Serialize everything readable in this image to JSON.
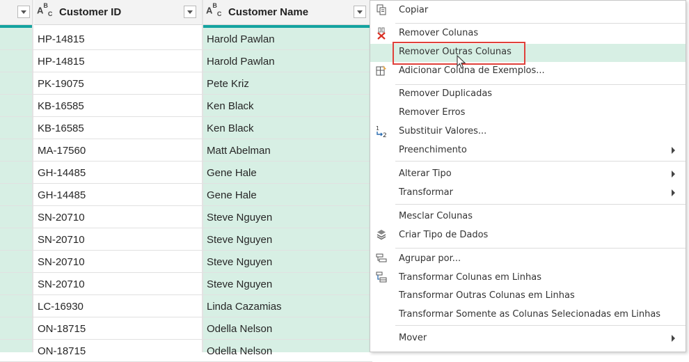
{
  "table": {
    "columns": [
      {
        "type_icon": "ABC",
        "name": "Customer ID"
      },
      {
        "type_icon": "ABC",
        "name": "Customer Name"
      }
    ],
    "rows": [
      {
        "customer_id": "HP-14815",
        "customer_name": "Harold Pawlan"
      },
      {
        "customer_id": "HP-14815",
        "customer_name": "Harold Pawlan"
      },
      {
        "customer_id": "PK-19075",
        "customer_name": "Pete Kriz"
      },
      {
        "customer_id": "KB-16585",
        "customer_name": "Ken Black"
      },
      {
        "customer_id": "KB-16585",
        "customer_name": "Ken Black"
      },
      {
        "customer_id": "MA-17560",
        "customer_name": "Matt Abelman"
      },
      {
        "customer_id": "GH-14485",
        "customer_name": "Gene Hale"
      },
      {
        "customer_id": "GH-14485",
        "customer_name": "Gene Hale"
      },
      {
        "customer_id": "SN-20710",
        "customer_name": "Steve Nguyen"
      },
      {
        "customer_id": "SN-20710",
        "customer_name": "Steve Nguyen"
      },
      {
        "customer_id": "SN-20710",
        "customer_name": "Steve Nguyen"
      },
      {
        "customer_id": "SN-20710",
        "customer_name": "Steve Nguyen"
      },
      {
        "customer_id": "LC-16930",
        "customer_name": "Linda Cazamias"
      },
      {
        "customer_id": "ON-18715",
        "customer_name": "Odella Nelson"
      },
      {
        "customer_id": "ON-18715",
        "customer_name": "Odella Nelson"
      }
    ]
  },
  "context_menu": {
    "items": [
      {
        "label": "Copiar",
        "icon": "copy-icon"
      },
      {
        "label": "Remover Colunas",
        "icon": "remove-columns-icon"
      },
      {
        "label": "Remover Outras Colunas",
        "icon": "",
        "highlighted": true
      },
      {
        "label": "Adicionar Coluna de Exemplos...",
        "icon": "column-from-examples-icon"
      },
      {
        "label": "Remover Duplicadas",
        "icon": ""
      },
      {
        "label": "Remover Erros",
        "icon": ""
      },
      {
        "label": "Substituir Valores...",
        "icon": "replace-values-icon"
      },
      {
        "label": "Preenchimento",
        "icon": "",
        "submenu": true
      },
      {
        "label": "Alterar Tipo",
        "icon": "",
        "submenu": true
      },
      {
        "label": "Transformar",
        "icon": "",
        "submenu": true
      },
      {
        "label": "Mesclar Colunas",
        "icon": ""
      },
      {
        "label": "Criar Tipo de Dados",
        "icon": "data-type-icon"
      },
      {
        "label": "Agrupar por...",
        "icon": "group-by-icon"
      },
      {
        "label": "Transformar Colunas em Linhas",
        "icon": "unpivot-icon"
      },
      {
        "label": "Transformar Outras Colunas em Linhas",
        "icon": ""
      },
      {
        "label": "Transformar Somente as Colunas Selecionadas em Linhas",
        "icon": ""
      },
      {
        "label": "Mover",
        "icon": "",
        "submenu": true
      }
    ]
  },
  "colors": {
    "selected_column_bg": "#d7efe4",
    "accent_bar": "#14a3a0",
    "highlight_border": "#e0403a"
  }
}
